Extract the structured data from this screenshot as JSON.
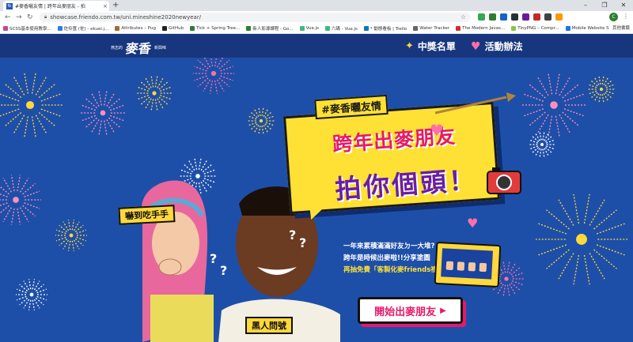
{
  "browser": {
    "tab_title": "#麥香曬友情 | 跨年出麥朋友 - 拍",
    "tab_favicon": "fb",
    "tab_close": "×",
    "new_tab": "+",
    "window_controls": [
      "–",
      "❐",
      "✕"
    ],
    "nav": {
      "back": "←",
      "forward": "→",
      "reload": "↻"
    },
    "url": "showcase.friendo.com.tw/uni.mineshine2020newyear/",
    "profile_letter": "C",
    "bookmarks": [
      {
        "label": "SCSS基本使用教學...",
        "color": "#c04a8e"
      },
      {
        "label": "佐伶匯 (佐) - ekuei.j...",
        "color": "#2c7be5"
      },
      {
        "label": "Attributes – Pug",
        "color": "#a46b3a"
      },
      {
        "label": "GitHub",
        "color": "#222222"
      },
      {
        "label": "Tick + Spring Tree...",
        "color": "#2e7d32"
      },
      {
        "label": "新人影導課程 - Go...",
        "color": "#2e7d32"
      },
      {
        "label": "Vue.js",
        "color": "#41b883"
      },
      {
        "label": "六碼 - Vue.js",
        "color": "#41b883"
      },
      {
        "label": "* 動態看板 | Trello",
        "color": "#0079bf"
      },
      {
        "label": "Water Tracker",
        "color": "#666666"
      },
      {
        "label": "The Modern Javas...",
        "color": "#d32f2f"
      },
      {
        "label": "TinyPNG – Compr...",
        "color": "#8bc34a"
      },
      {
        "label": "Mobile Website S...",
        "color": "#1a73e8"
      }
    ],
    "other_bookmarks": "其他書籤",
    "extension_colors": [
      "#34a853",
      "#2e7d32",
      "#1565c0",
      "#263238",
      "#6a1b9a",
      "#c62828",
      "#424242",
      "#ff9800"
    ]
  },
  "site": {
    "logo_small": "燕志的",
    "logo_big": "麥香",
    "logo_tail": "新興味",
    "nav": [
      {
        "label": "中獎名單",
        "icon": "sparkle-icon"
      },
      {
        "label": "活動辦法",
        "icon": "heart-icon"
      }
    ]
  },
  "hero": {
    "hashtag": "#麥香曬友情",
    "line1": "跨年出麥朋友",
    "line2": "拍你個頭！",
    "desc_lines": [
      "一年來累積滿滿好友ㄉ一大堆?",
      "跨年是時候出麥啦!!分享塗圖",
      "再抽免費「客製化麥friends禮盒」"
    ],
    "cta": "開始出麥朋友",
    "cta_arrow": "▶",
    "label_girl": "嚇到吃手手",
    "label_guy": "黑人問號",
    "question_marks": [
      "?",
      "?",
      "?",
      "?"
    ]
  },
  "colors": {
    "bg": "#1e4fa8",
    "nav": "#18367e",
    "yellow": "#ffe135",
    "pink": "#e6196b",
    "purple": "#6a1da8"
  }
}
